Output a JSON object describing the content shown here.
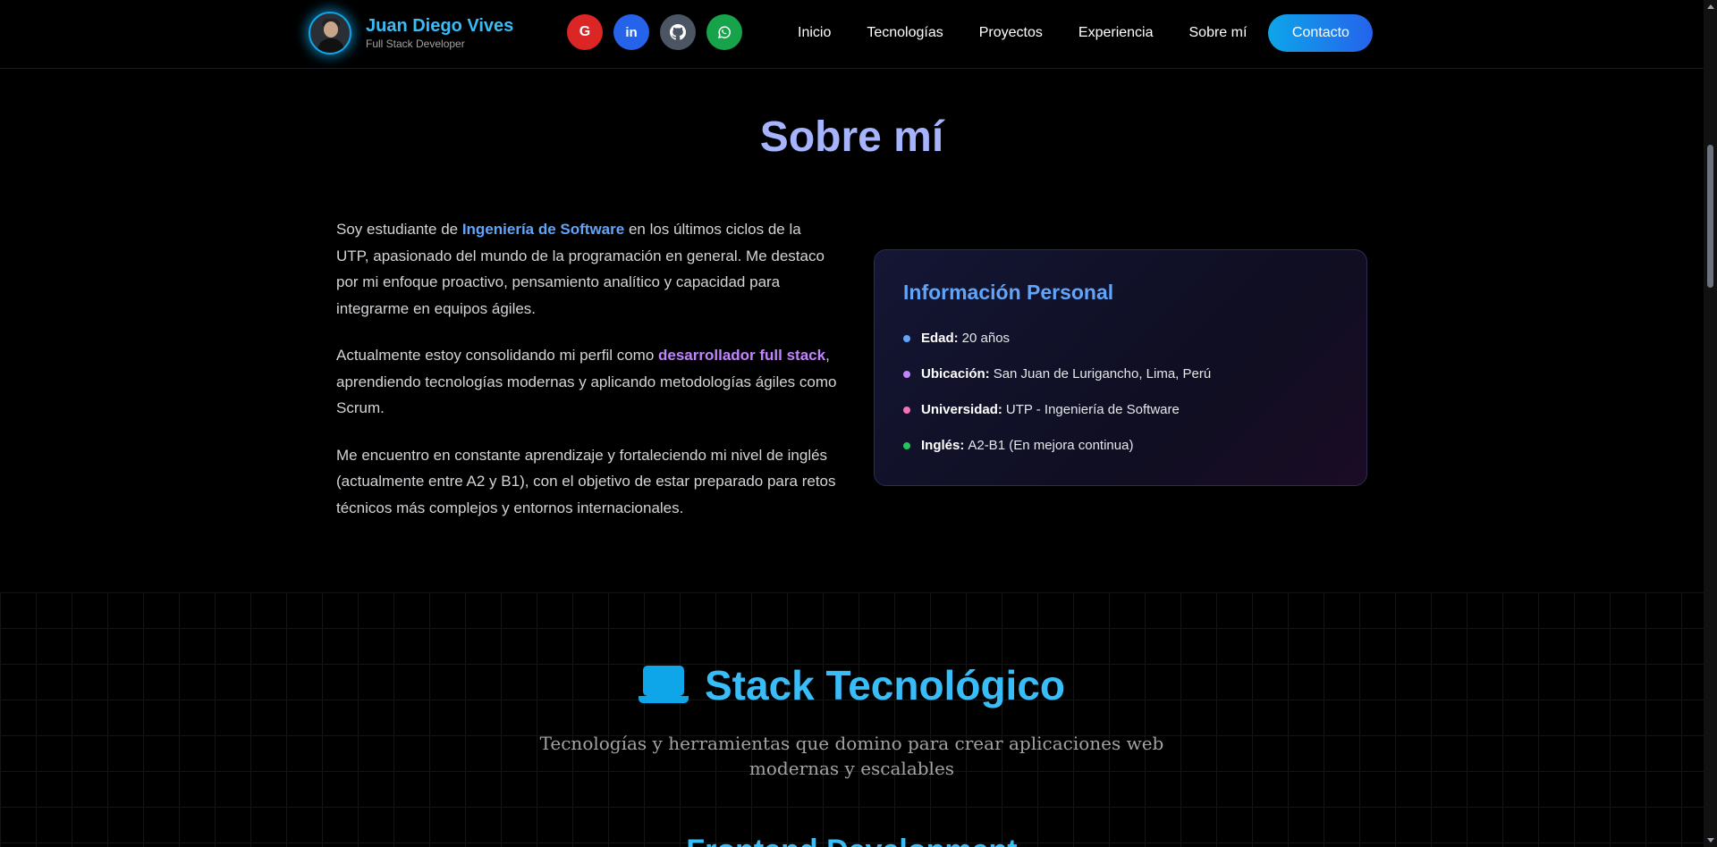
{
  "header": {
    "brand_name": "Juan Diego Vives",
    "brand_role": "Full Stack Developer",
    "socials": [
      {
        "label": "G",
        "name": "google-icon"
      },
      {
        "label": "in",
        "name": "linkedin-icon"
      },
      {
        "label": "",
        "name": "github-icon"
      },
      {
        "label": "",
        "name": "whatsapp-icon"
      }
    ],
    "nav": [
      "Inicio",
      "Tecnologías",
      "Proyectos",
      "Experiencia",
      "Sobre mí"
    ],
    "contact_label": "Contacto"
  },
  "about": {
    "title": "Sobre mí",
    "p1_a": "Soy estudiante de ",
    "p1_hl": "Ingeniería de Software",
    "p1_b": " en los últimos ciclos de la UTP, apasionado del mundo de la programación en general. Me destaco por mi enfoque proactivo, pensamiento analítico y capacidad para integrarme en equipos ágiles.",
    "p2_a": "Actualmente estoy consolidando mi perfil como ",
    "p2_hl": "desarrollador full stack",
    "p2_b": ", aprendiendo tecnologías modernas y aplicando metodologías ágiles como Scrum.",
    "p3": "Me encuentro en constante aprendizaje y fortaleciendo mi nivel de inglés (actualmente entre A2 y B1), con el objetivo de estar preparado para retos técnicos más complejos y entornos internacionales."
  },
  "info": {
    "title": "Información Personal",
    "items": [
      {
        "label": "Edad:",
        "value": "20 años",
        "color": "#60a5fa"
      },
      {
        "label": "Ubicación:",
        "value": "San Juan de Lurigancho, Lima, Perú",
        "color": "#c084fc"
      },
      {
        "label": "Universidad:",
        "value": "UTP - Ingeniería de Software",
        "color": "#f472b6"
      },
      {
        "label": "Inglés:",
        "value": "A2-B1 (En mejora continua)",
        "color": "#22c55e"
      }
    ]
  },
  "stack": {
    "title": "Stack Tecnológico",
    "subtitle": "Tecnologías y herramientas que domino para crear aplicaciones web modernas y escalables",
    "next_title": "Frontend Development"
  },
  "colors": {
    "accent": "#38bdf8",
    "title": "#a5b4fc"
  }
}
